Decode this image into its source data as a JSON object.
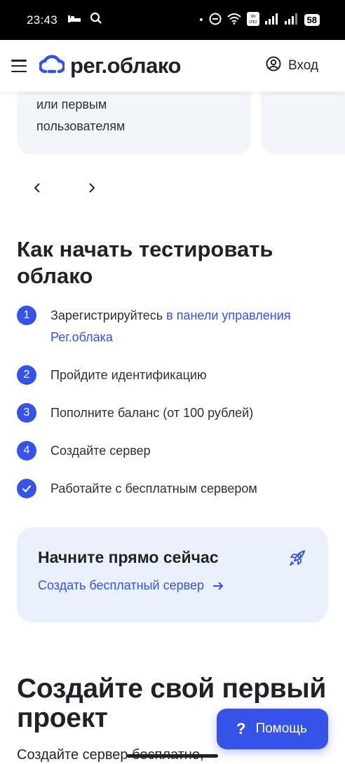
{
  "status_bar": {
    "time": "23:43",
    "battery": "58"
  },
  "header": {
    "logo_text": "рег.облако",
    "login_label": "Вход"
  },
  "carousel": {
    "card_text_line1": "или первым",
    "card_text_line2": "пользователям"
  },
  "section": {
    "title": "Как начать тестировать облако",
    "steps": [
      {
        "num": "1",
        "text": "Зарегистрируйтесь ",
        "link": "в панели управления Рег.облака"
      },
      {
        "num": "2",
        "text": "Пройдите идентификацию"
      },
      {
        "num": "3",
        "text": "Пополните баланс (от 100 рублей)"
      },
      {
        "num": "4",
        "text": "Создайте сервер"
      },
      {
        "num": "",
        "text": "Работайте с бесплатным сервером"
      }
    ]
  },
  "cta": {
    "title": "Начните прямо сейчас",
    "link": "Создать бесплатный сервер"
  },
  "project": {
    "title": "Создайте свой первый проект",
    "subtext": "Создайте сервер бесплатно,"
  },
  "help_button": {
    "icon": "?",
    "label": "Помощь"
  },
  "colors": {
    "accent": "#3553e9",
    "card_bg": "#f2f5fa",
    "cta_bg": "#eaf1fc"
  }
}
